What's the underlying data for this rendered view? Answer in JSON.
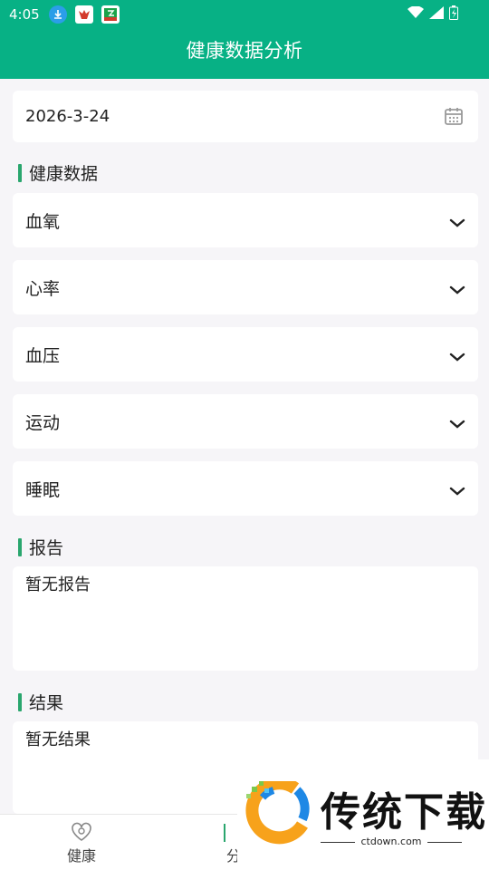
{
  "status": {
    "time": "4:05"
  },
  "header": {
    "title": "健康数据分析"
  },
  "date_picker": {
    "value": "2026-3-24"
  },
  "health_section": {
    "title": "健康数据",
    "items": [
      {
        "label": "血氧"
      },
      {
        "label": "心率"
      },
      {
        "label": "血压"
      },
      {
        "label": "运动"
      },
      {
        "label": "睡眠"
      }
    ]
  },
  "report_section": {
    "title": "报告",
    "content": "暂无报告"
  },
  "result_section": {
    "title": "结果",
    "content": "暂无结果"
  },
  "tabs": [
    {
      "label": "健康"
    },
    {
      "label": "分"
    }
  ],
  "watermark": {
    "brand": "传统下载",
    "url": "ctdown.com"
  },
  "colors": {
    "primary": "#07b185",
    "section_bar": "#2aa66e",
    "background": "#f6f5f8"
  }
}
